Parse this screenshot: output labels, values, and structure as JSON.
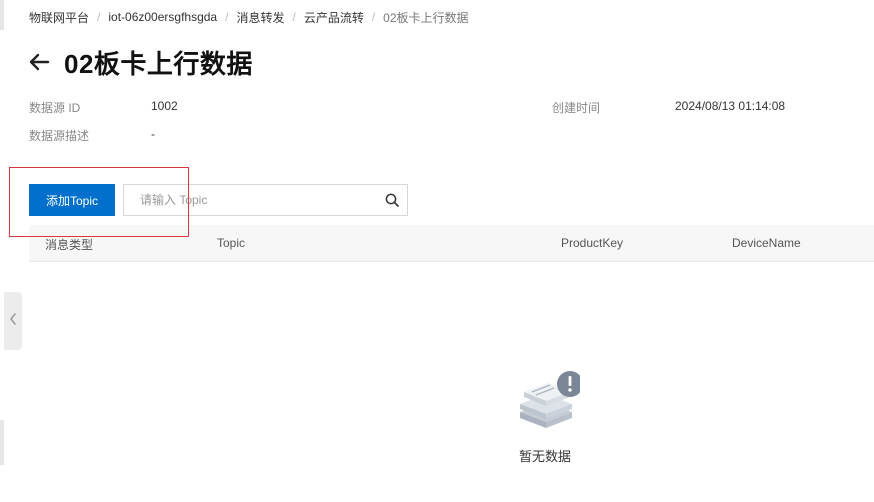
{
  "breadcrumb": {
    "items": [
      "物联网平台",
      "iot-06z00ersgfhsgda",
      "消息转发",
      "云产品流转",
      "02板卡上行数据"
    ],
    "separator": "/"
  },
  "header": {
    "title": "02板卡上行数据",
    "back_icon": "arrow-left-icon"
  },
  "details": {
    "source_id_label": "数据源 ID",
    "source_id_value": "1002",
    "created_label": "创建时间",
    "created_value": "2024/08/13 01:14:08",
    "desc_label": "数据源描述",
    "desc_value": "-"
  },
  "toolbar": {
    "add_label": "添加Topic",
    "search_placeholder": "请输入 Topic",
    "search_icon": "search-icon"
  },
  "table": {
    "columns": [
      "消息类型",
      "Topic",
      "ProductKey",
      "DeviceName"
    ],
    "rows": []
  },
  "empty": {
    "text": "暂无数据",
    "icon": "empty-data-icon"
  },
  "colors": {
    "primary": "#0070cc",
    "highlight": "#d9363e",
    "header_bg": "#f7f7f7"
  }
}
